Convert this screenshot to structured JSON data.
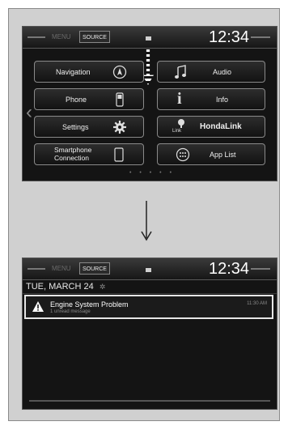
{
  "home": {
    "menu_label": "MENU",
    "source_label": "SOURCE",
    "time": "12:34",
    "tiles": {
      "navigation": "Navigation",
      "phone": "Phone",
      "settings": "Settings",
      "smartphone": "Smartphone\nConnection",
      "audio": "Audio",
      "info": "Info",
      "hondalink": "HondaLink",
      "hondalink_icon_text": "Link",
      "app_list": "App List"
    },
    "page_dots": "• • • • •"
  },
  "notifications": {
    "menu_label": "MENU",
    "source_label": "SOURCE",
    "time": "12:34",
    "date": "TUE, MARCH 24",
    "item": {
      "title": "Engine System Problem",
      "subtitle": "1 unread message",
      "time": "11:30 AM"
    }
  },
  "colors": {
    "screen_bg": "#141414",
    "tile_border": "#8a8a8a",
    "text": "#f0f0f0",
    "frame_bg": "#d0d0d0"
  }
}
